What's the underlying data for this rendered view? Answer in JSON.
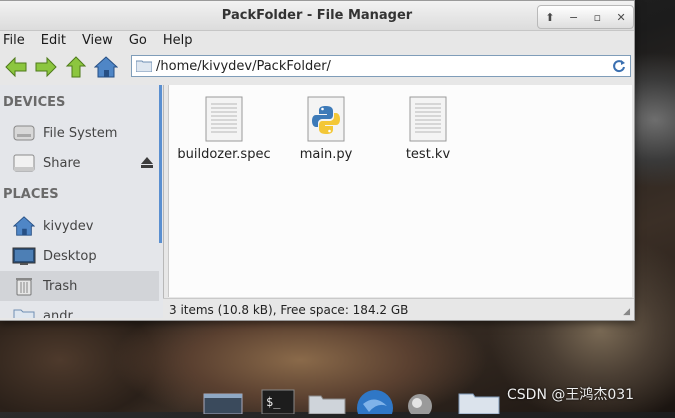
{
  "window": {
    "title": "PackFolder - File Manager",
    "controls": {
      "up": "⬆",
      "minimize": "−",
      "maximize": "▫",
      "close": "✕"
    }
  },
  "menu": [
    "File",
    "Edit",
    "View",
    "Go",
    "Help"
  ],
  "toolbar": {
    "back_icon": "back-arrow-icon",
    "forward_icon": "forward-arrow-icon",
    "up_icon": "up-arrow-icon",
    "home_icon": "home-icon"
  },
  "location": {
    "path": "/home/kivydev/PackFolder/"
  },
  "sidebar": {
    "devices_heading": "DEVICES",
    "places_heading": "PLACES",
    "devices": [
      {
        "label": "File System",
        "icon": "harddisk-icon"
      },
      {
        "label": "Share",
        "icon": "drive-icon"
      }
    ],
    "places": [
      {
        "label": "kivydev",
        "icon": "home-icon"
      },
      {
        "label": "Desktop",
        "icon": "desktop-icon"
      },
      {
        "label": "Trash",
        "icon": "trash-icon"
      },
      {
        "label": "andr",
        "icon": "folder-icon"
      }
    ]
  },
  "files": [
    {
      "name": "buildozer.spec",
      "icon": "text-file-icon"
    },
    {
      "name": "main.py",
      "icon": "python-file-icon"
    },
    {
      "name": "test.kv",
      "icon": "text-file-icon"
    }
  ],
  "status": {
    "text": "3 items (10.8 kB), Free space: 184.2 GB"
  },
  "watermark": "CSDN @王鸿杰031"
}
